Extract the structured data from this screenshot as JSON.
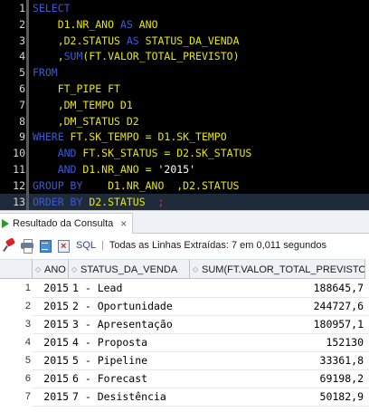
{
  "editor": {
    "lines": [
      {
        "n": "1",
        "tokens": [
          {
            "t": "SELECT",
            "c": "kw"
          }
        ]
      },
      {
        "n": "2",
        "tokens": [
          {
            "t": "    D1.NR_ANO ",
            "c": "id"
          },
          {
            "t": "AS",
            "c": "kw"
          },
          {
            "t": " ANO",
            "c": "id"
          }
        ]
      },
      {
        "n": "3",
        "tokens": [
          {
            "t": "    ,D2.STATUS ",
            "c": "id"
          },
          {
            "t": "AS",
            "c": "kw"
          },
          {
            "t": " STATUS_DA_VENDA",
            "c": "id"
          }
        ]
      },
      {
        "n": "4",
        "tokens": [
          {
            "t": "    ,",
            "c": "punc"
          },
          {
            "t": "SUM",
            "c": "kw"
          },
          {
            "t": "(FT.VALOR_TOTAL_PREVISTO)",
            "c": "id"
          }
        ]
      },
      {
        "n": "5",
        "tokens": [
          {
            "t": "FROM",
            "c": "kw"
          }
        ]
      },
      {
        "n": "6",
        "tokens": [
          {
            "t": "    FT_PIPE FT",
            "c": "id"
          }
        ]
      },
      {
        "n": "7",
        "tokens": [
          {
            "t": "    ,DM_TEMPO D1",
            "c": "id"
          }
        ]
      },
      {
        "n": "8",
        "tokens": [
          {
            "t": "    ,DM_STATUS D2",
            "c": "id"
          }
        ]
      },
      {
        "n": "9",
        "tokens": [
          {
            "t": "WHERE",
            "c": "kw"
          },
          {
            "t": " FT.SK_TEMPO = D1.SK_TEMPO",
            "c": "id"
          }
        ]
      },
      {
        "n": "10",
        "tokens": [
          {
            "t": "    ",
            "c": "id"
          },
          {
            "t": "AND",
            "c": "kw"
          },
          {
            "t": " FT.SK_STATUS = D2.SK_STATUS",
            "c": "id"
          }
        ]
      },
      {
        "n": "11",
        "tokens": [
          {
            "t": "    ",
            "c": "id"
          },
          {
            "t": "AND",
            "c": "kw"
          },
          {
            "t": " D1.NR_ANO = ",
            "c": "id"
          },
          {
            "t": "'2015'",
            "c": "str"
          }
        ]
      },
      {
        "n": "12",
        "tokens": [
          {
            "t": "GROUP BY",
            "c": "kw"
          },
          {
            "t": "    D1.NR_ANO  ,D2.STATUS",
            "c": "id"
          }
        ]
      },
      {
        "n": "13",
        "tokens": [
          {
            "t": "ORDER BY",
            "c": "kw"
          },
          {
            "t": " D2.STATUS  ",
            "c": "id"
          },
          {
            "t": ";",
            "c": "cursor-caret"
          }
        ]
      }
    ]
  },
  "results": {
    "tab_label": "Resultado da Consulta",
    "tab_close": "×",
    "sql_label": "SQL",
    "separator": "|",
    "status_text": "Todas as Linhas Extraídas: 7 em 0,011 segundos",
    "columns": [
      "ANO",
      "STATUS_DA_VENDA",
      "SUM(FT.VALOR_TOTAL_PREVISTO)"
    ],
    "rows": [
      {
        "n": "1",
        "ano": "2015",
        "status": "1 - Lead",
        "total": "188645,7"
      },
      {
        "n": "2",
        "ano": "2015",
        "status": "2 - Oportunidade",
        "total": "244727,6"
      },
      {
        "n": "3",
        "ano": "2015",
        "status": "3 - Apresentação",
        "total": "180957,1"
      },
      {
        "n": "4",
        "ano": "2015",
        "status": "4 - Proposta",
        "total": "152130"
      },
      {
        "n": "5",
        "ano": "2015",
        "status": "5 - Pipeline",
        "total": "33361,8"
      },
      {
        "n": "6",
        "ano": "2015",
        "status": "6 - Forecast",
        "total": "69198,2"
      },
      {
        "n": "7",
        "ano": "2015",
        "status": "7 - Desistência",
        "total": "50182,9"
      }
    ]
  },
  "icons": [
    "pin-icon",
    "print-icon",
    "export-icon",
    "delete-icon",
    "sort-icon",
    "play-icon"
  ],
  "colors": {
    "editor_bg": "#000000",
    "keyword": "#3b5bd8",
    "identifier": "#e8e800",
    "string": "#ffffff"
  }
}
